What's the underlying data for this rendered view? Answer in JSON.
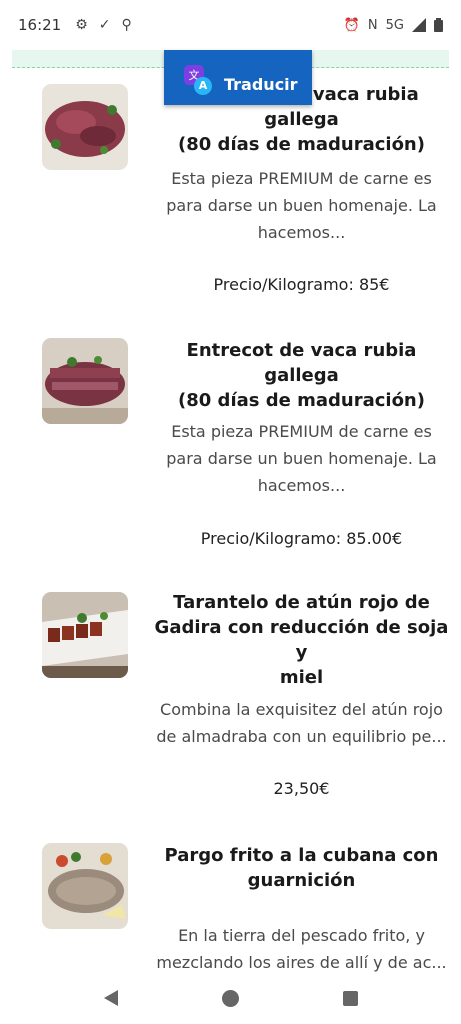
{
  "status_bar": {
    "time": "16:21",
    "icons_left": [
      "gear-icon",
      "check-download-icon",
      "location-icon"
    ],
    "icons_right": [
      "alarm-icon",
      "nfc-icon",
      "5g-icon",
      "signal-icon",
      "battery-icon"
    ],
    "network": "5G"
  },
  "translate_button": {
    "label": "Traducir",
    "logo_letter_a": "文",
    "logo_letter_b": "A",
    "colors": {
      "bg": "#1565c0",
      "logo_primary": "#7b3fe4",
      "logo_secondary": "#29b6f6"
    }
  },
  "items": [
    {
      "title_line1": "Chuletón de vaca rubia gallega",
      "title_line2": "(80 días de maduración)",
      "title_line3": "",
      "desc_line1": "Esta pieza PREMIUM de carne es",
      "desc_line2": "para darse un buen homenaje. La",
      "desc_line3": "hacemos...",
      "price": "Precio/Kilogramo: 85€"
    },
    {
      "title_line1": "Entrecot de vaca rubia gallega",
      "title_line2": "(80 días de maduración)",
      "title_line3": "",
      "desc_line1": "Esta pieza PREMIUM de carne es",
      "desc_line2": "para darse un buen homenaje. La",
      "desc_line3": "hacemos...",
      "price": "Precio/Kilogramo: 85.00€"
    },
    {
      "title_line1": "Tarantelo de atún rojo de",
      "title_line2": "Gadira con reducción de soja y",
      "title_line3": "miel",
      "desc_line1": "Combina la exquisitez del atún rojo",
      "desc_line2": "de almadraba con un equilibrio pe...",
      "desc_line3": "",
      "price": "23,50€"
    },
    {
      "title_line1": "Pargo frito a la cubana con",
      "title_line2": "guarnición",
      "title_line3": "",
      "desc_line1": "En la tierra del pescado frito, y",
      "desc_line2": "mezclando los aires de allí y de ac...",
      "desc_line3": "",
      "price": ""
    }
  ],
  "nav_bar": {
    "icons": [
      "back-icon",
      "home-icon",
      "recents-icon"
    ]
  }
}
